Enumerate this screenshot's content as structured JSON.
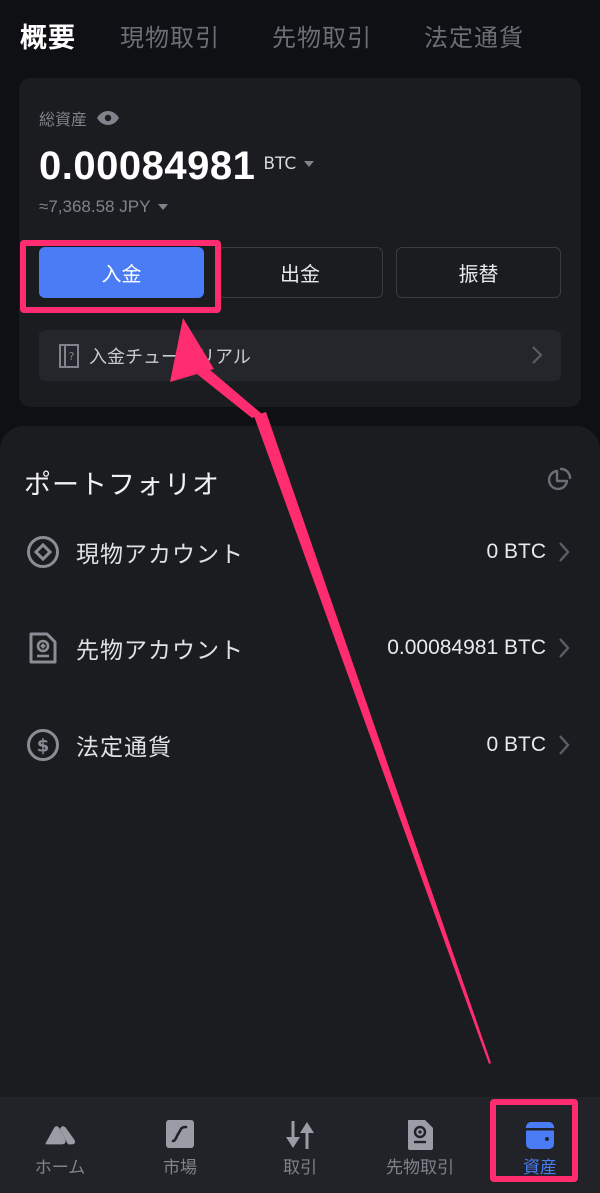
{
  "top_tabs": [
    {
      "label": "概要",
      "active": true
    },
    {
      "label": "現物取引",
      "active": false
    },
    {
      "label": "先物取引",
      "active": false
    },
    {
      "label": "法定通貨",
      "active": false
    }
  ],
  "overview": {
    "total_label": "総資産",
    "balance": "0.00084981",
    "balance_unit": "BTC",
    "fiat_equivalent": "≈7,368.58 JPY",
    "actions": {
      "deposit": "入金",
      "withdraw": "出金",
      "transfer": "振替"
    },
    "tutorial_label": "入金チュートリアル"
  },
  "portfolio": {
    "title": "ポートフォリオ",
    "accounts": [
      {
        "label": "現物アカウント",
        "value": "0 BTC",
        "icon": "spot-coin-icon"
      },
      {
        "label": "先物アカウント",
        "value": "0.00084981 BTC",
        "icon": "futures-document-icon"
      },
      {
        "label": "法定通貨",
        "value": "0 BTC",
        "icon": "dollar-coin-icon"
      }
    ]
  },
  "bottom_nav": [
    {
      "label": "ホーム",
      "icon": "home-mountain-icon",
      "active": false
    },
    {
      "label": "市場",
      "icon": "market-chart-icon",
      "active": false
    },
    {
      "label": "取引",
      "icon": "trade-arrows-icon",
      "active": false
    },
    {
      "label": "先物取引",
      "icon": "futures-document-icon",
      "active": false
    },
    {
      "label": "資産",
      "icon": "wallet-icon",
      "active": true
    }
  ],
  "colors": {
    "accent": "#4a7cf6",
    "annotation": "#ff2d6f",
    "background": "#0f1013",
    "card": "#1b1c20"
  }
}
